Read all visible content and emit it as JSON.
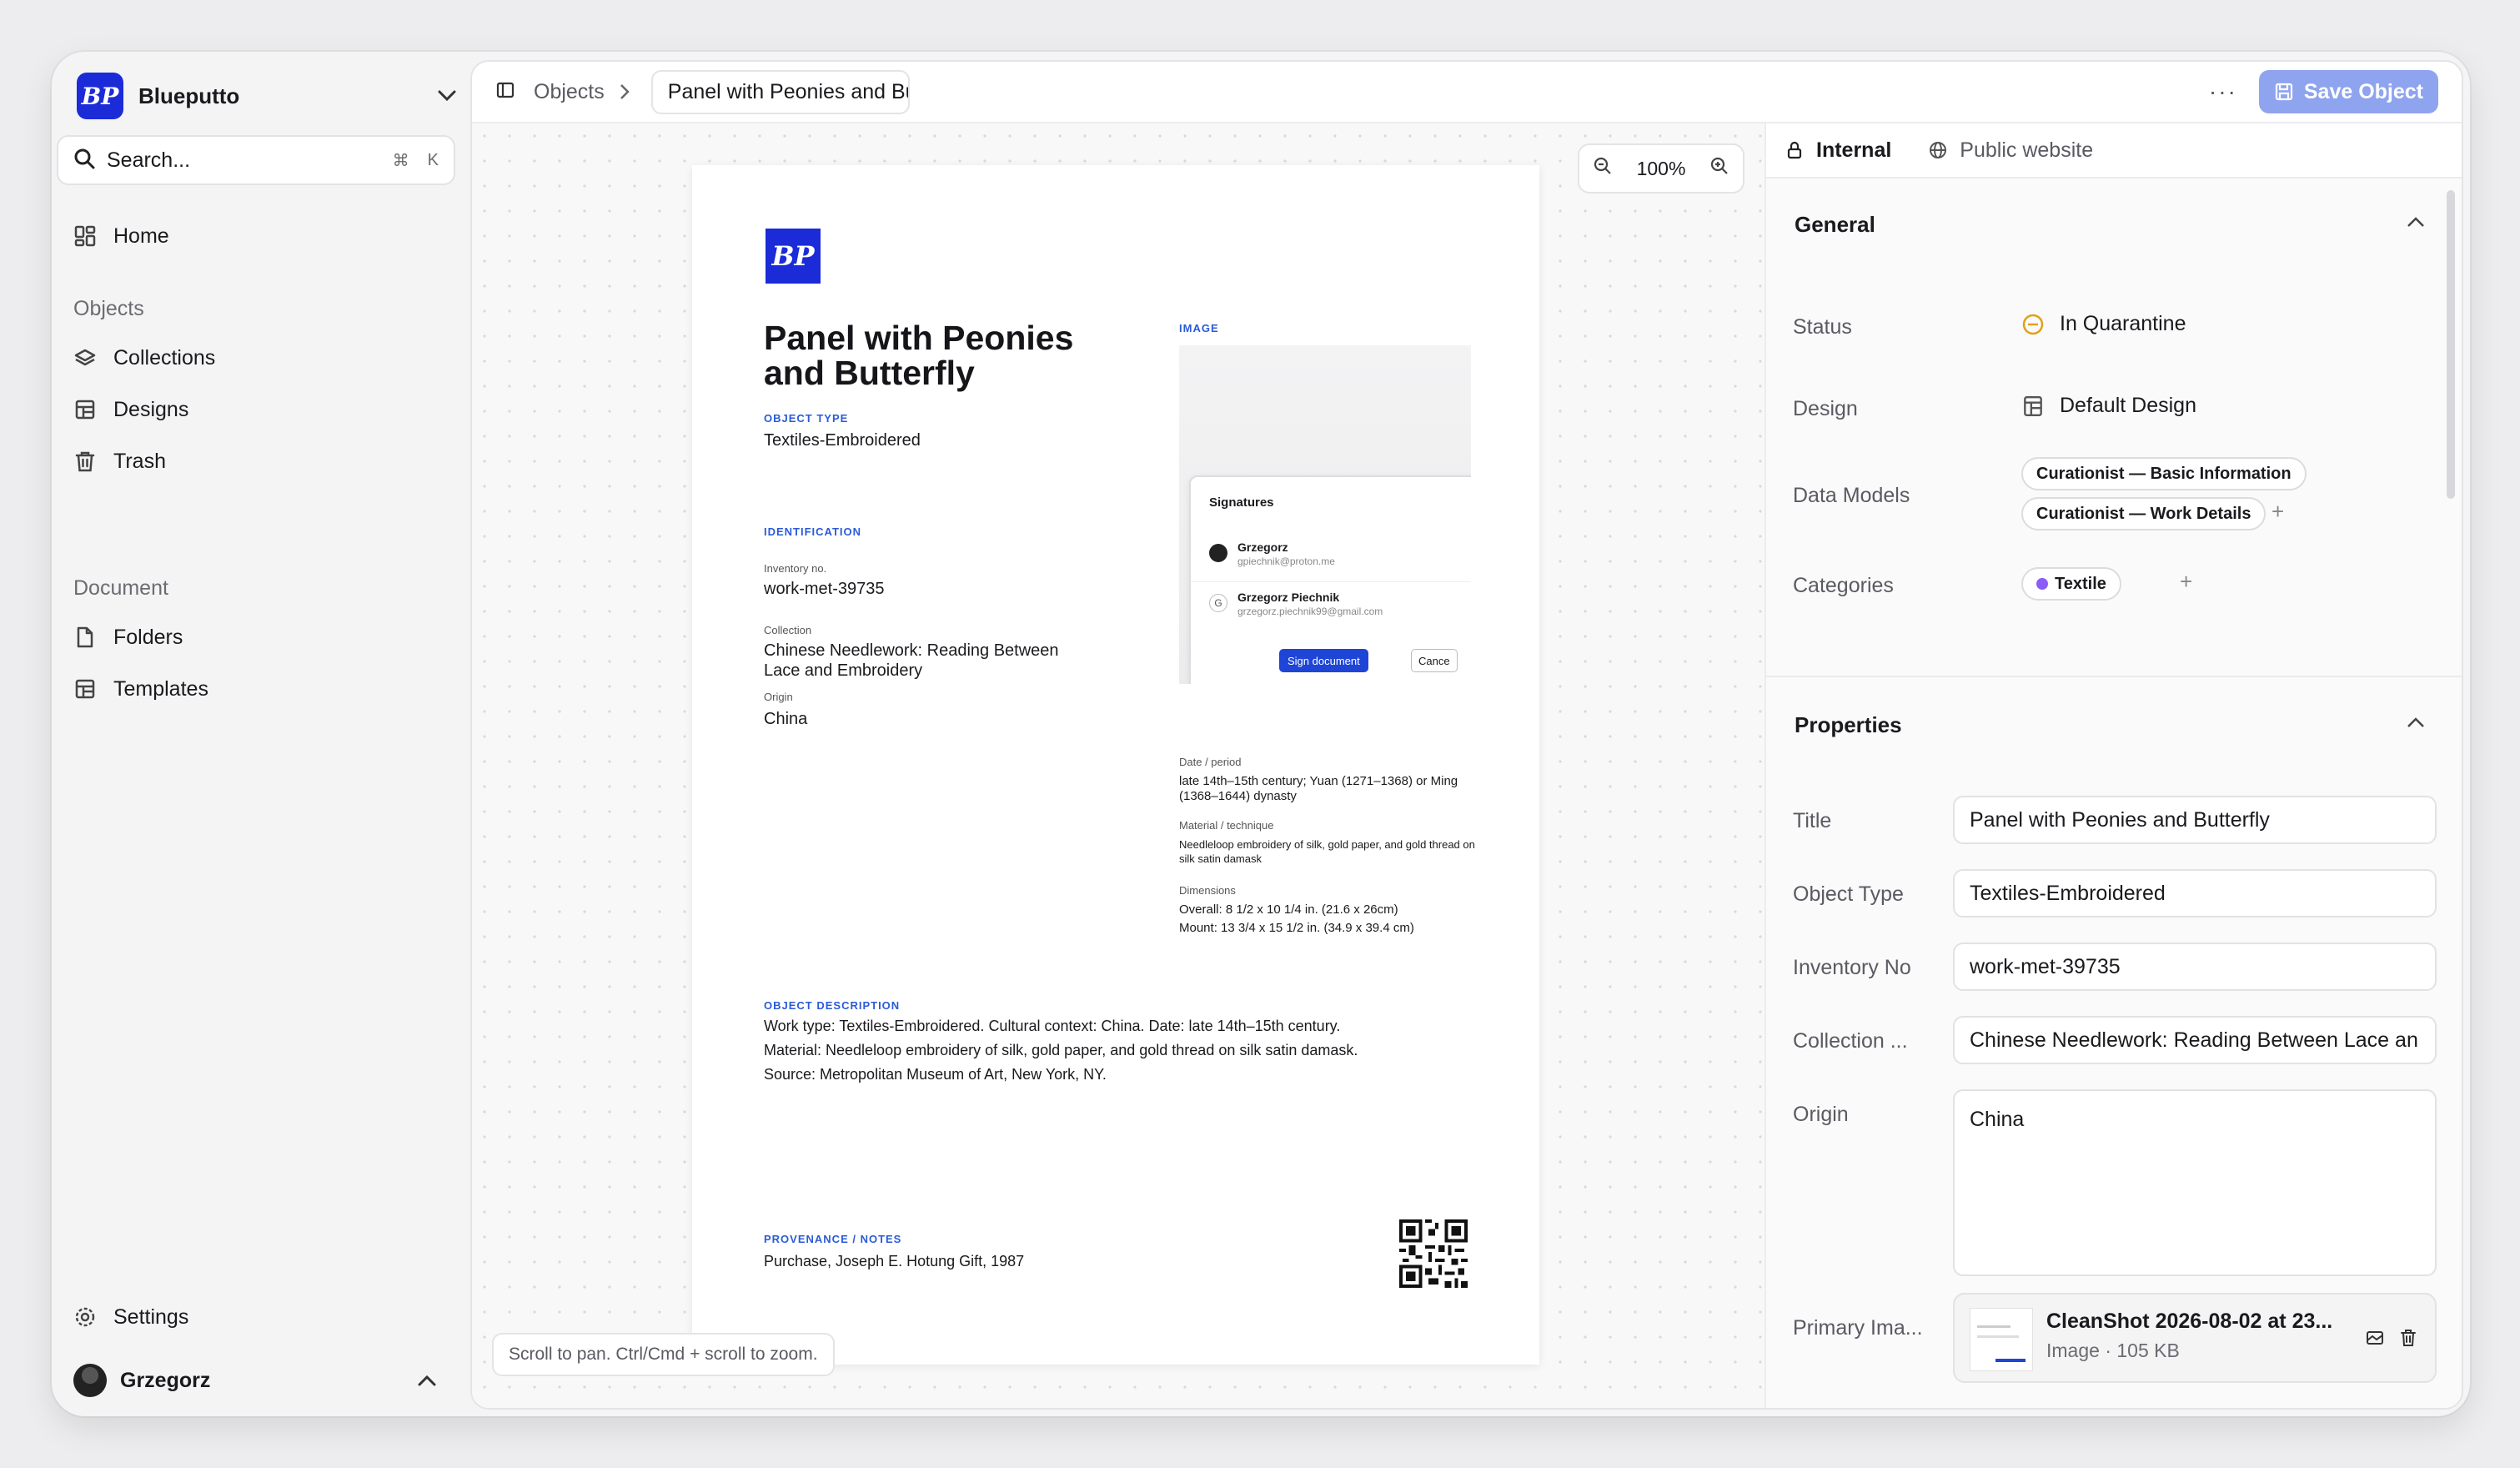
{
  "sidebar": {
    "workspace": {
      "logo_text": "BP",
      "name": "Blueputto"
    },
    "search": {
      "label": "Search...",
      "shortcut_cmd": "⌘",
      "shortcut_key": "K"
    },
    "home_label": "Home",
    "objects_section": "Objects",
    "objects_items": [
      {
        "label": "Collections",
        "icon": "layers-icon"
      },
      {
        "label": "Designs",
        "icon": "layout-icon"
      },
      {
        "label": "Trash",
        "icon": "trash-icon"
      }
    ],
    "document_section": "Document",
    "document_items": [
      {
        "label": "Folders",
        "icon": "file-icon"
      },
      {
        "label": "Templates",
        "icon": "template-icon"
      }
    ],
    "settings_label": "Settings",
    "user_name": "Grzegorz"
  },
  "topbar": {
    "breadcrumb_root": "Objects",
    "breadcrumb_current": "Panel with Peonies and Butterfly",
    "more": "···",
    "save_label": "Save Object"
  },
  "canvas": {
    "zoom": "100%",
    "hint": "Scroll to pan. Ctrl/Cmd + scroll to zoom."
  },
  "document": {
    "logo_text": "BP",
    "title": "Panel with Peonies and Butterfly",
    "object_type_label": "OBJECT TYPE",
    "object_type": "Textiles-Embroidered",
    "identification_label": "IDENTIFICATION",
    "inventory_label": "Inventory no.",
    "inventory": "work-met-39735",
    "collection_label": "Collection",
    "collection": "Chinese Needlework: Reading Between Lace and Embroidery",
    "origin_label": "Origin",
    "origin": "China",
    "image_label": "IMAGE",
    "signatures": {
      "title": "Signatures",
      "rows": [
        {
          "name": "Grzegorz",
          "email": "gpiechnik@proton.me"
        },
        {
          "name": "Grzegorz Piechnik",
          "email": "grzegorz.piechnik99@gmail.com",
          "initial": "G"
        }
      ],
      "sign_label": "Sign document",
      "cancel_label": "Cance"
    },
    "date_label": "Date / period",
    "date": "late 14th–15th century; Yuan (1271–1368) or Ming (1368–1644) dynasty",
    "material_label": "Material / technique",
    "material": "Needleloop embroidery of silk, gold paper, and gold thread on silk satin damask",
    "dimensions_label": "Dimensions",
    "dimensions_1": "Overall: 8 1/2 x 10 1/4 in. (21.6 x 26cm)",
    "dimensions_2": "Mount: 13 3/4 x 15 1/2 in. (34.9 x 39.4 cm)",
    "description_label": "OBJECT DESCRIPTION",
    "description_1": "Work type: Textiles-Embroidered. Cultural context: China. Date: late 14th–15th century.",
    "description_2": "Material: Needleloop embroidery of silk, gold paper, and gold thread on silk satin damask.",
    "description_3": "Source: Metropolitan Museum of Art, New York, NY.",
    "provenance_label": "PROVENANCE / NOTES",
    "provenance": "Purchase, Joseph E. Hotung Gift, 1987"
  },
  "panel": {
    "tabs": [
      {
        "label": "Internal",
        "icon": "lock-icon"
      },
      {
        "label": "Public website",
        "icon": "globe-icon"
      }
    ],
    "general": {
      "title": "General",
      "status_label": "Status",
      "status": "In Quarantine",
      "status_color": "#e0a21b",
      "design_label": "Design",
      "design": "Default Design",
      "data_models_label": "Data Models",
      "data_models": [
        "Curationist — Basic Information",
        "Curationist — Work Details"
      ],
      "categories_label": "Categories",
      "category": "Textile",
      "category_color": "#8b5cf6",
      "add_symbol": "+"
    },
    "properties": {
      "title": "Properties",
      "title_label": "Title",
      "title_value": "Panel with Peonies and Butterfly",
      "type_label": "Object Type",
      "type_value": "Textiles-Embroidered",
      "inv_label": "Inventory No",
      "inv_value": "work-met-39735",
      "coll_label": "Collection ...",
      "coll_value": "Chinese Needlework: Reading Between Lace an",
      "origin_label": "Origin",
      "origin_value": "China",
      "image_label": "Primary Ima...",
      "image_name": "CleanShot 2026-08-02 at 23...",
      "image_meta": "Image · 105 KB"
    }
  },
  "colors": {
    "accent": "#1b2bd8",
    "save_button": "#8fa4ef",
    "label_blue": "#2a5bd7"
  }
}
